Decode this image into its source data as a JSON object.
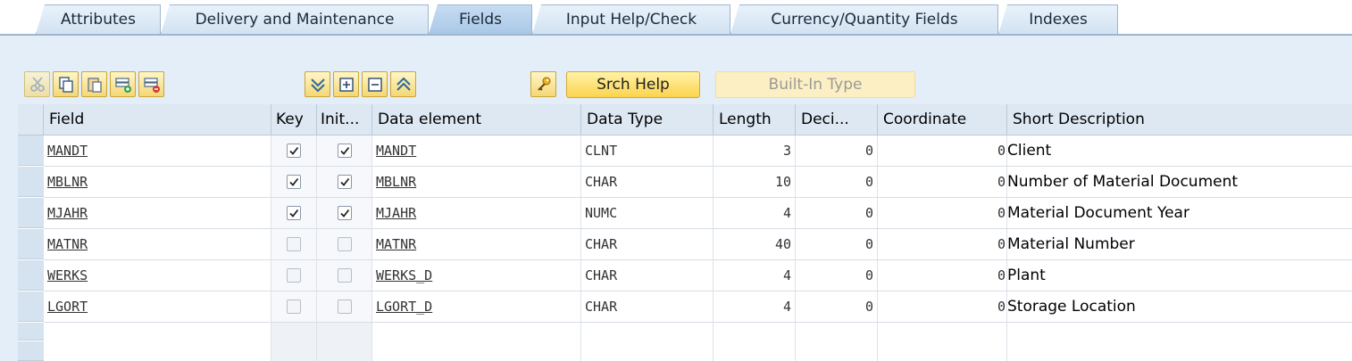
{
  "tabs": [
    "Attributes",
    "Delivery and Maintenance",
    "Fields",
    "Input Help/Check",
    "Currency/Quantity Fields",
    "Indexes"
  ],
  "active_tab": "Fields",
  "toolbar": {
    "icons": [
      "cut-icon",
      "copy-icon",
      "paste-icon",
      "insert-row-icon",
      "delete-row-icon",
      "move-down-icon",
      "expand-icon",
      "collapse-icon",
      "move-up-icon",
      "key-icon"
    ],
    "srch_help": "Srch Help",
    "builtin_type": "Built-In Type"
  },
  "columns": {
    "field": "Field",
    "key": "Key",
    "init": "Init...",
    "data_element": "Data element",
    "data_type": "Data Type",
    "length": "Length",
    "deci": "Deci...",
    "coordinate": "Coordinate",
    "short_desc": "Short Description"
  },
  "rows": [
    {
      "field": "MANDT",
      "key": true,
      "init": true,
      "data_element": "MANDT",
      "data_type": "CLNT",
      "length": "3",
      "deci": "0",
      "coordinate": "0",
      "short_desc": "Client"
    },
    {
      "field": "MBLNR",
      "key": true,
      "init": true,
      "data_element": "MBLNR",
      "data_type": "CHAR",
      "length": "10",
      "deci": "0",
      "coordinate": "0",
      "short_desc": "Number of Material Document"
    },
    {
      "field": "MJAHR",
      "key": true,
      "init": true,
      "data_element": "MJAHR",
      "data_type": "NUMC",
      "length": "4",
      "deci": "0",
      "coordinate": "0",
      "short_desc": "Material Document Year"
    },
    {
      "field": "MATNR",
      "key": false,
      "init": false,
      "data_element": "MATNR",
      "data_type": "CHAR",
      "length": "40",
      "deci": "0",
      "coordinate": "0",
      "short_desc": "Material Number"
    },
    {
      "field": "WERKS",
      "key": false,
      "init": false,
      "data_element": "WERKS_D",
      "data_type": "CHAR",
      "length": "4",
      "deci": "0",
      "coordinate": "0",
      "short_desc": "Plant"
    },
    {
      "field": "LGORT",
      "key": false,
      "init": false,
      "data_element": "LGORT_D",
      "data_type": "CHAR",
      "length": "4",
      "deci": "0",
      "coordinate": "0",
      "short_desc": "Storage Location"
    }
  ],
  "colors": {
    "background": "#e3eef9",
    "button_yellow": "#fbd44e",
    "header": "#dde8f3"
  }
}
